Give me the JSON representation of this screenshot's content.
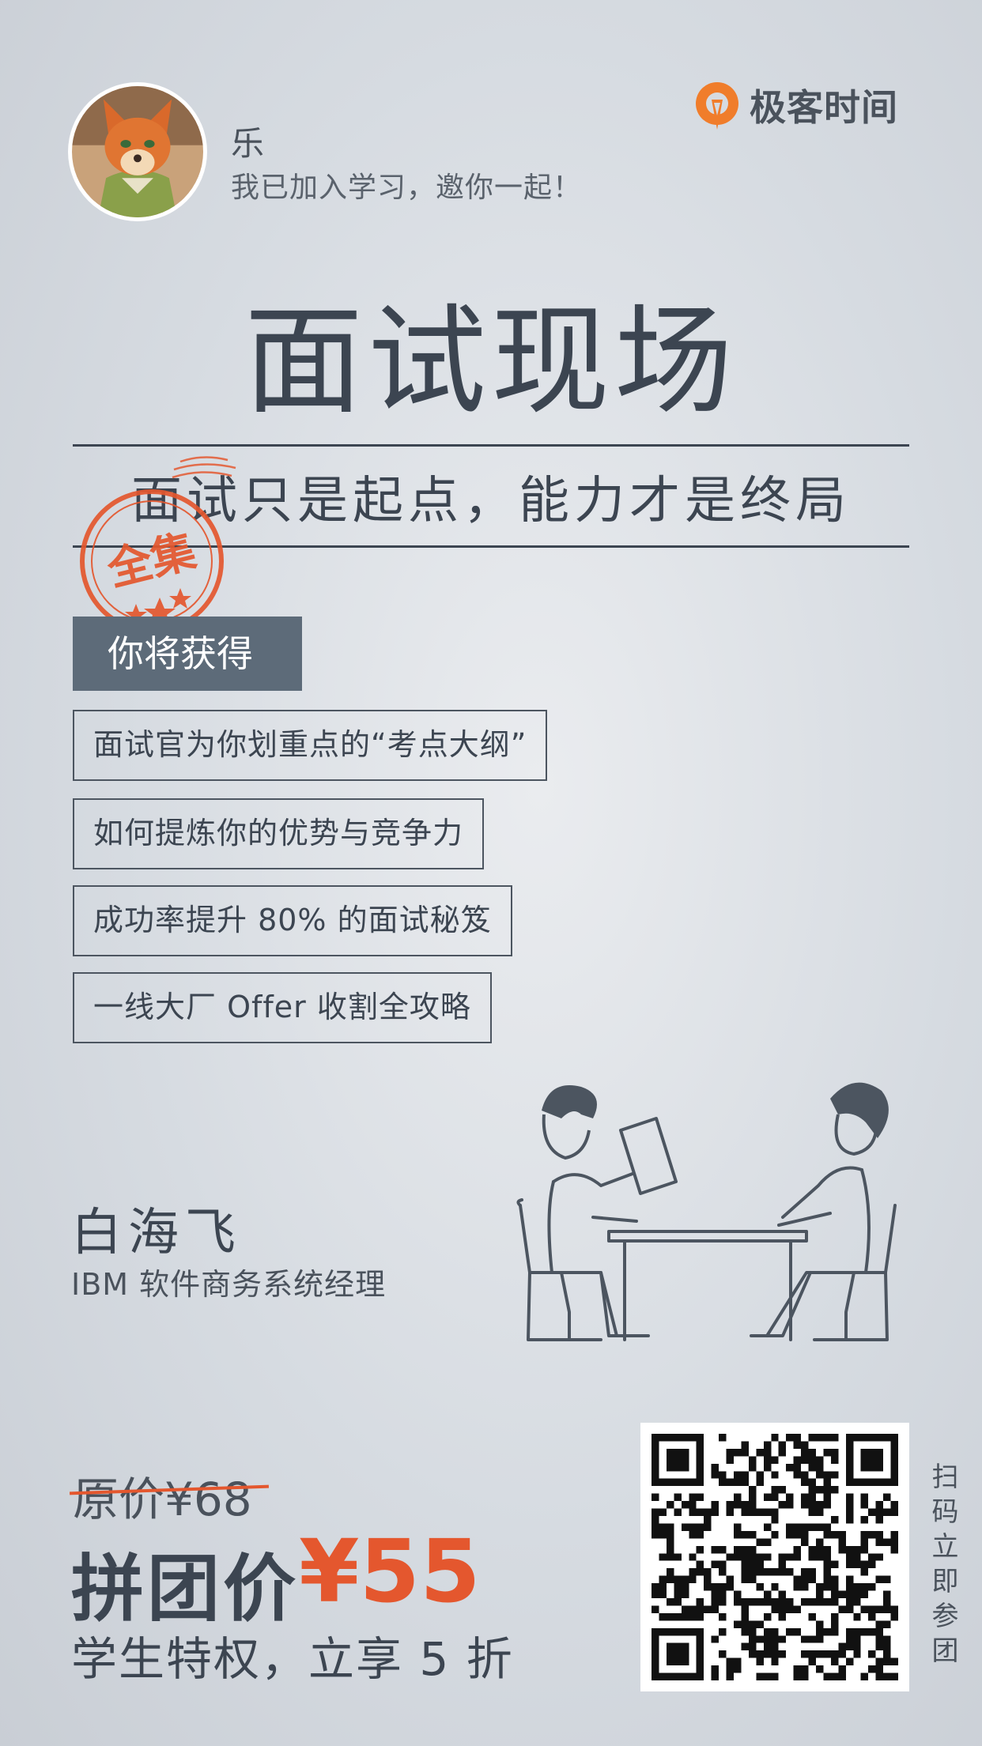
{
  "header": {
    "user_name": "乐",
    "user_message": "我已加入学习，邀你一起！",
    "brand_name": "极客时间"
  },
  "course": {
    "title": "面试现场",
    "subtitle": "面试只是起点，能力才是终局",
    "stamp_text": "全集"
  },
  "gains": {
    "heading": "你将获得",
    "items": [
      {
        "label": "面试官为你划重点的“考点大纲”"
      },
      {
        "label": "如何提炼你的优势与竞争力"
      },
      {
        "label": "成功率提升 80% 的面试秘笈"
      },
      {
        "label": "一线大厂 Offer 收割全攻略"
      }
    ]
  },
  "instructor": {
    "name": "白海飞",
    "title": "IBM 软件商务系统经理"
  },
  "pricing": {
    "original_price": "原价¥68",
    "group_label": "拼团价",
    "group_price": "¥55",
    "student_offer": "学生特权，立享 5 折",
    "accent_color": "#e4572e"
  },
  "qr": {
    "action_text": "扫码立即参团"
  },
  "icons": [
    "avatar-fox",
    "geek-time-logo-icon",
    "stamp-icon",
    "interview-illustration",
    "qr-code"
  ]
}
